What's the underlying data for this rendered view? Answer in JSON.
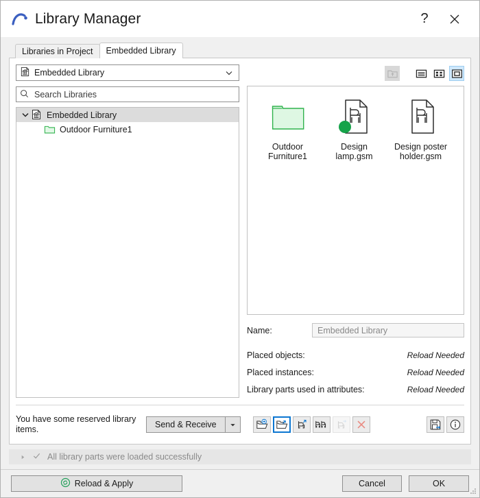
{
  "window": {
    "title": "Library Manager",
    "logo_icon": "archicad-arc-logo",
    "help_label": "?",
    "help_icon": "question-mark-icon",
    "close_icon": "close-x-icon"
  },
  "tabs": [
    {
      "label": "Libraries in Project",
      "active": false
    },
    {
      "label": "Embedded Library",
      "active": true
    }
  ],
  "left": {
    "library_select": {
      "value": "Embedded Library",
      "icon": "embedded-library-icon",
      "chevron_icon": "chevron-down-icon"
    },
    "search": {
      "placeholder": "Search Libraries",
      "value": "",
      "icon": "search-icon"
    },
    "tree": [
      {
        "label": "Embedded Library",
        "icon": "embedded-library-icon",
        "twisty_icon": "chevron-down-icon",
        "selected": true,
        "level": 0
      },
      {
        "label": "Outdoor Furniture1",
        "icon": "folder-green-icon",
        "selected": false,
        "level": 1
      }
    ]
  },
  "right": {
    "view_buttons": [
      {
        "name": "go-up-folder-icon",
        "state": "disabled"
      },
      {
        "name": "list-view-icon",
        "state": "normal"
      },
      {
        "name": "grid-view-icon",
        "state": "normal"
      },
      {
        "name": "large-icon-view-icon",
        "state": "active"
      }
    ],
    "items": [
      {
        "caption": "Outdoor Furniture1",
        "icon": "folder-green-icon",
        "badge": "none"
      },
      {
        "caption": "Design lamp.gsm",
        "icon": "gsm-file-chair-icon",
        "badge": "green-dot"
      },
      {
        "caption": "Design poster holder.gsm",
        "icon": "gsm-file-chair-icon",
        "badge": "none"
      }
    ],
    "info": {
      "name_label": "Name:",
      "name_value": "Embedded Library",
      "rows": [
        {
          "label": "Placed objects:",
          "value": "Reload Needed"
        },
        {
          "label": "Placed instances:",
          "value": "Reload Needed"
        },
        {
          "label": "Library parts used in attributes:",
          "value": "Reload Needed"
        }
      ]
    }
  },
  "actions": {
    "reserved_message": "You have some reserved library items.",
    "send_receive_label": "Send & Receive",
    "send_receive_arrow_icon": "caret-down-icon",
    "tools": [
      {
        "name": "add-library-icon",
        "state": "normal"
      },
      {
        "name": "open-library-icon",
        "state": "selected"
      },
      {
        "name": "add-object-icon",
        "state": "normal"
      },
      {
        "name": "duplicate-objects-icon",
        "state": "normal"
      },
      {
        "name": "move-object-icon",
        "state": "disabled"
      },
      {
        "name": "remove-object-icon",
        "state": "normal"
      }
    ],
    "right_tools": [
      {
        "name": "save-library-icon",
        "state": "normal"
      },
      {
        "name": "info-icon",
        "state": "normal"
      }
    ]
  },
  "status": {
    "expander_icon": "caret-right-icon",
    "check_icon": "check-icon",
    "message": "All library parts were loaded successfully"
  },
  "footer": {
    "reload_label": "Reload & Apply",
    "reload_icon": "refresh-circle-icon",
    "cancel_label": "Cancel",
    "ok_label": "OK",
    "grip_icon": "resize-grip-icon"
  },
  "colors": {
    "accent_blue": "#0b76d1",
    "green": "#16a34a",
    "folder_green": "#2fb24c",
    "logo_blue": "#3b5fc0",
    "remove_red": "#e98b82"
  }
}
